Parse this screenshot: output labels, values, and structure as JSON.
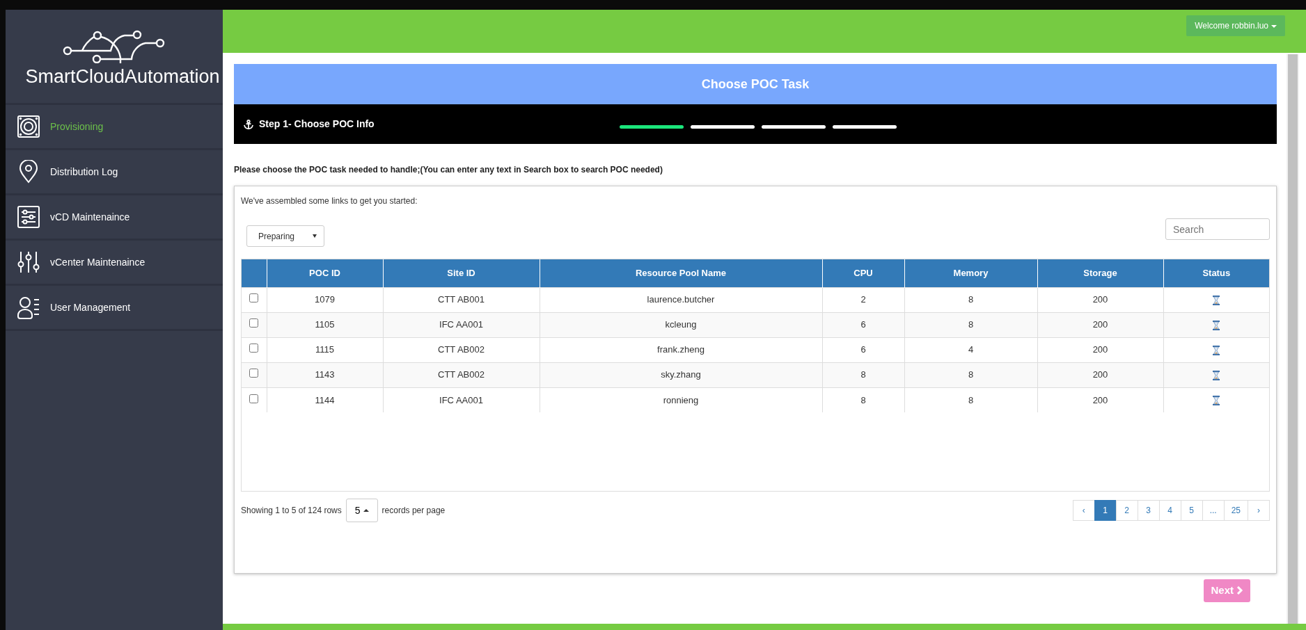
{
  "logo": {
    "text": "SmartCloudAutomation"
  },
  "sidebar": {
    "items": [
      {
        "label": "Provisioning",
        "selected": true,
        "kind": "speaker"
      },
      {
        "label": "Distribution Log",
        "selected": false,
        "kind": "pin"
      },
      {
        "label": "vCD Maintenaince",
        "selected": false,
        "kind": "panel"
      },
      {
        "label": "vCenter Maintenaince",
        "selected": false,
        "kind": "sliders"
      },
      {
        "label": "User Management",
        "selected": false,
        "kind": "user"
      }
    ]
  },
  "header": {
    "user_menu": "Welcome robbin.luo"
  },
  "panel": {
    "title": "Choose POC Task",
    "step_label": "Step 1- Choose POC Info",
    "steps": [
      {
        "selected": true
      },
      {
        "selected": false
      },
      {
        "selected": false
      },
      {
        "selected": false
      }
    ]
  },
  "instruction": "Please choose the POC task needed to handle;(You can enter any text in Search box to search POC needed)",
  "card": {
    "intro": "We've assembled some links to get you started:",
    "filter": {
      "value": "Preparing"
    },
    "search": {
      "placeholder": "Search"
    },
    "table": {
      "columns": [
        "POC ID",
        "Site ID",
        "Resource Pool Name",
        "CPU",
        "Memory",
        "Storage",
        "Status"
      ],
      "rows": [
        {
          "checked": false,
          "cells": [
            "1079",
            "CTT AB001",
            "laurence.butcher",
            "2",
            "8",
            "200"
          ],
          "kind": "pending"
        },
        {
          "checked": false,
          "cells": [
            "1105",
            "IFC AA001",
            "kcleung",
            "6",
            "8",
            "200"
          ],
          "kind": "pending"
        },
        {
          "checked": false,
          "cells": [
            "1115",
            "CTT AB002",
            "frank.zheng",
            "6",
            "4",
            "200"
          ],
          "kind": "pending"
        },
        {
          "checked": false,
          "cells": [
            "1143",
            "CTT AB002",
            "sky.zhang",
            "8",
            "8",
            "200"
          ],
          "kind": "pending"
        },
        {
          "checked": false,
          "cells": [
            "1144",
            "IFC AA001",
            "ronnieng",
            "8",
            "8",
            "200"
          ],
          "kind": "pending"
        }
      ]
    },
    "pagination": {
      "summary": "Showing 1 to 5 of 124 rows",
      "page_size": "5",
      "suffix": "records per page",
      "pages": [
        {
          "label": "‹",
          "selected": false
        },
        {
          "label": "1",
          "selected": true
        },
        {
          "label": "2",
          "selected": false
        },
        {
          "label": "3",
          "selected": false
        },
        {
          "label": "4",
          "selected": false
        },
        {
          "label": "5",
          "selected": false
        },
        {
          "label": "...",
          "selected": false
        },
        {
          "label": "25",
          "selected": false
        },
        {
          "label": "›",
          "selected": false
        }
      ]
    }
  },
  "next_button": {
    "label": "Next"
  }
}
